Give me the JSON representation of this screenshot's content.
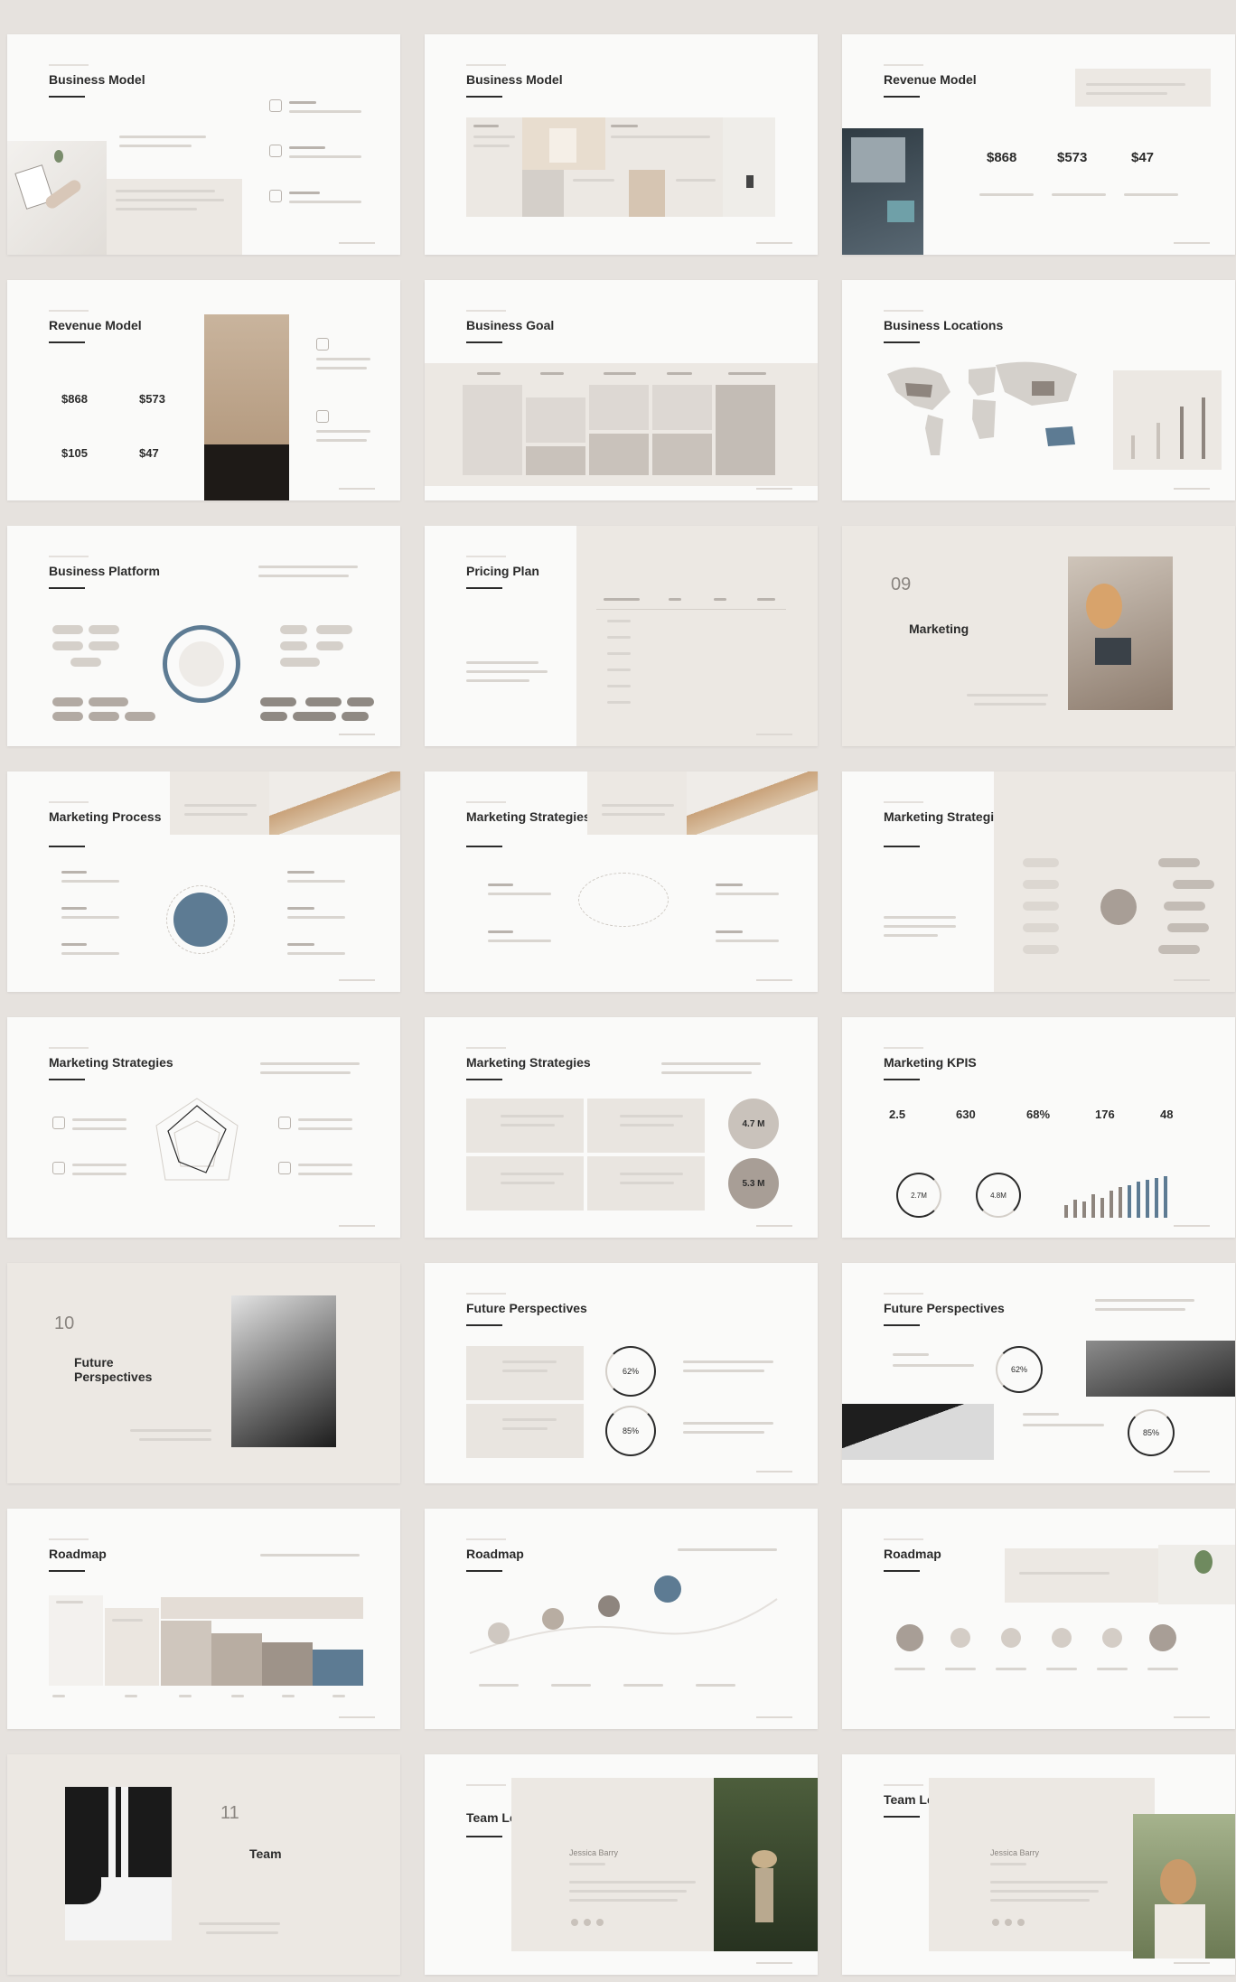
{
  "slides": [
    {
      "title": "Business Model"
    },
    {
      "title": "Business Model"
    },
    {
      "title": "Revenue Model",
      "values": [
        "$868",
        "$573",
        "$47"
      ]
    },
    {
      "title": "Revenue Model",
      "values": [
        "$868",
        "$573",
        "$105",
        "$47"
      ]
    },
    {
      "title": "Business Goal"
    },
    {
      "title": "Business Locations"
    },
    {
      "title": "Business Platform"
    },
    {
      "title": "Pricing Plan"
    },
    {
      "title": "Marketing",
      "number": "09"
    },
    {
      "title": "Marketing Process"
    },
    {
      "title": "Marketing Strategies"
    },
    {
      "title": "Marketing Strategies"
    },
    {
      "title": "Marketing Strategies"
    },
    {
      "title": "Marketing Strategies",
      "circles": [
        "4.7 M",
        "5.3 M"
      ]
    },
    {
      "title": "Marketing KPIS",
      "values": [
        "2.5",
        "630",
        "68%",
        "176",
        "48"
      ],
      "rings": [
        "2.7M",
        "4.8M"
      ]
    },
    {
      "title": "Future Perspectives",
      "number": "10"
    },
    {
      "title": "Future Perspectives",
      "rings": [
        "62%",
        "85%"
      ]
    },
    {
      "title": "Future Perspectives",
      "rings": [
        "62%",
        "85%"
      ]
    },
    {
      "title": "Roadmap"
    },
    {
      "title": "Roadmap"
    },
    {
      "title": "Roadmap"
    },
    {
      "title": "Team",
      "number": "11"
    },
    {
      "title": "Team Leader",
      "name": "Jessica Barry"
    },
    {
      "title": "Team Leader",
      "name": "Jessica Barry"
    }
  ],
  "colors": {
    "background": "#e6e2de",
    "slide": "#fafaf9",
    "beige": "#ece8e3",
    "accent": "#5d7b93",
    "taupe": "#a89e96",
    "text": "#2b2b2b"
  }
}
